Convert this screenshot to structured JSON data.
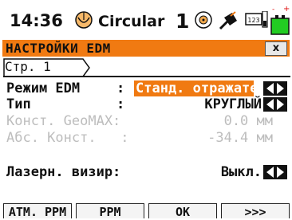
{
  "status": {
    "time": "14:36",
    "mode": "Circular",
    "face": "1"
  },
  "title": {
    "text": "НАСТРОЙКИ EDM",
    "close": "x"
  },
  "tab": {
    "label": "Стр.  1"
  },
  "rows": {
    "edm_mode": {
      "label": "Режим EDM",
      "colon": ":",
      "value": "Станд. отражатель"
    },
    "type": {
      "label": "Тип",
      "colon": ":",
      "value": "КРУГЛЫЙ"
    },
    "const_geomax": {
      "label": "Конст. GeoMAX:",
      "value": "0.0 мм"
    },
    "abs_const": {
      "label": "Абс. Конст.   :",
      "value": "-34.4 мм"
    },
    "laser": {
      "label": "Лазерн. визир:",
      "value": "Выкл."
    }
  },
  "softkeys": [
    "АТМ. PPM",
    "PPM",
    "OK",
    ">>>"
  ]
}
